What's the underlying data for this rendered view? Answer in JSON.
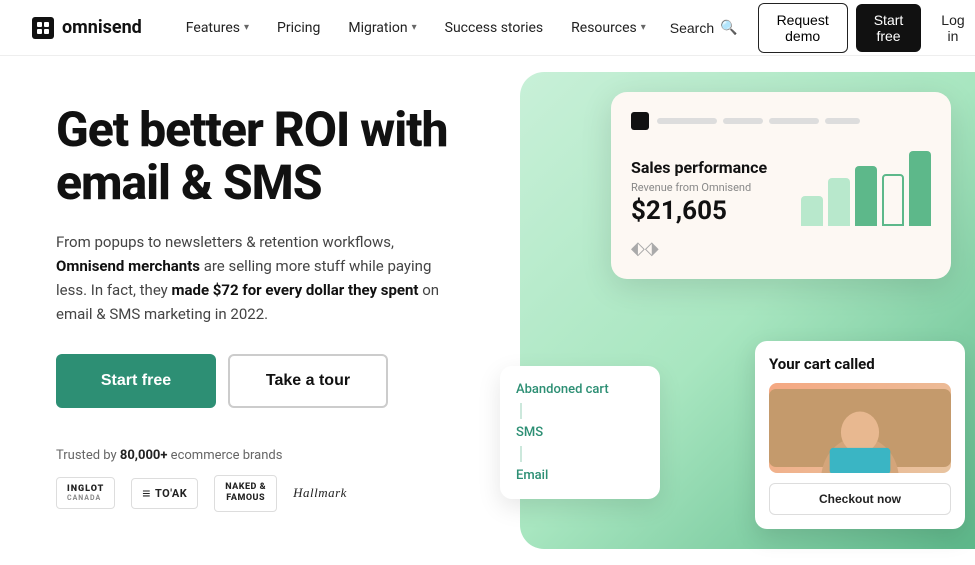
{
  "nav": {
    "logo_text": "omnisend",
    "links": [
      {
        "label": "Features",
        "has_dropdown": true
      },
      {
        "label": "Pricing",
        "has_dropdown": false
      },
      {
        "label": "Migration",
        "has_dropdown": true
      },
      {
        "label": "Success stories",
        "has_dropdown": false
      },
      {
        "label": "Resources",
        "has_dropdown": true
      }
    ],
    "search_label": "Search",
    "request_demo_label": "Request demo",
    "start_free_label": "Start free",
    "login_label": "Log in"
  },
  "hero": {
    "title": "Get better ROI with email & SMS",
    "description_1": "From popups to newsletters & retention workflows, ",
    "description_bold": "Omnisend merchants",
    "description_2": " are selling more stuff while paying less. In fact, they ",
    "description_bold2": "made $72 for every dollar they spent",
    "description_3": " on email & SMS marketing in 2022.",
    "cta_primary": "Start free",
    "cta_secondary": "Take a tour",
    "trusted_text_1": "Trusted by ",
    "trusted_bold": "80,000+",
    "trusted_text_2": " ecommerce brands",
    "brands": [
      {
        "name": "INGLOT",
        "sub": "CANADA"
      },
      {
        "name": "TO'AK",
        "prefix": "≡"
      },
      {
        "name": "NAKED & FAMOUS"
      },
      {
        "name": "Hallmark"
      }
    ]
  },
  "dashboard": {
    "subtitle": "Sales performance",
    "revenue_label": "Revenue from Omnisend",
    "revenue": "$21,605",
    "bars": [
      {
        "height": 30,
        "type": "light"
      },
      {
        "height": 50,
        "type": "light"
      },
      {
        "height": 65,
        "type": "solid"
      },
      {
        "height": 55,
        "type": "outline"
      },
      {
        "height": 75,
        "type": "solid"
      }
    ]
  },
  "funnel": {
    "items": [
      {
        "label": "Abandoned cart"
      },
      {
        "label": "SMS"
      },
      {
        "label": "Email"
      }
    ]
  },
  "cart_popup": {
    "title": "Your cart called",
    "checkout_label": "Checkout now"
  }
}
